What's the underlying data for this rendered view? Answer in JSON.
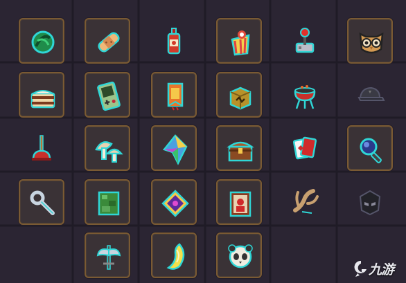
{
  "inventory": {
    "rows": [
      [
        {
          "icon": "green-melon-icon",
          "framed": true
        },
        {
          "icon": "bandage-icon",
          "framed": true
        },
        {
          "icon": "hot-sauce-bottle-icon",
          "framed": false
        },
        {
          "icon": "popcorn-bucket-icon",
          "framed": true
        },
        {
          "icon": "joystick-icon",
          "framed": false
        },
        {
          "icon": "owl-mask-icon",
          "framed": true
        }
      ],
      [
        {
          "icon": "layer-cake-icon",
          "framed": true
        },
        {
          "icon": "handheld-console-icon",
          "framed": true
        },
        {
          "icon": "orange-banner-icon",
          "framed": true
        },
        {
          "icon": "gold-block-icon",
          "framed": true
        },
        {
          "icon": "bbq-grill-icon",
          "framed": false
        },
        {
          "icon": "dark-cap-icon",
          "framed": false
        }
      ],
      [
        {
          "icon": "plunger-icon",
          "framed": false
        },
        {
          "icon": "mushrooms-icon",
          "framed": true
        },
        {
          "icon": "rainbow-crystal-icon",
          "framed": true
        },
        {
          "icon": "treasure-chest-icon",
          "framed": true
        },
        {
          "icon": "playing-cards-icon",
          "framed": false
        },
        {
          "icon": "magnifier-icon",
          "framed": true
        }
      ],
      [
        {
          "icon": "wrench-icon",
          "framed": true
        },
        {
          "icon": "green-map-icon",
          "framed": true
        },
        {
          "icon": "purple-spellbook-icon",
          "framed": true
        },
        {
          "icon": "portrait-frame-icon",
          "framed": true
        },
        {
          "icon": "claw-icon",
          "framed": false
        },
        {
          "icon": "dark-helmet-icon",
          "framed": false
        }
      ],
      [
        {
          "icon": "empty-slot-icon",
          "framed": false
        },
        {
          "icon": "double-axe-icon",
          "framed": true
        },
        {
          "icon": "yellow-fang-icon",
          "framed": true
        },
        {
          "icon": "panda-skull-icon",
          "framed": true
        },
        {
          "icon": "empty-slot-icon",
          "framed": false
        },
        {
          "icon": "empty-slot-icon",
          "framed": false
        }
      ]
    ]
  },
  "colors": {
    "background": "#2b2533",
    "slot_fill": "#3a3236",
    "slot_border": "#7a5a33",
    "item_outline": "#2fd6d6"
  },
  "watermark": {
    "logo_icon": "jiuyou-logo-icon",
    "text": "九游"
  }
}
